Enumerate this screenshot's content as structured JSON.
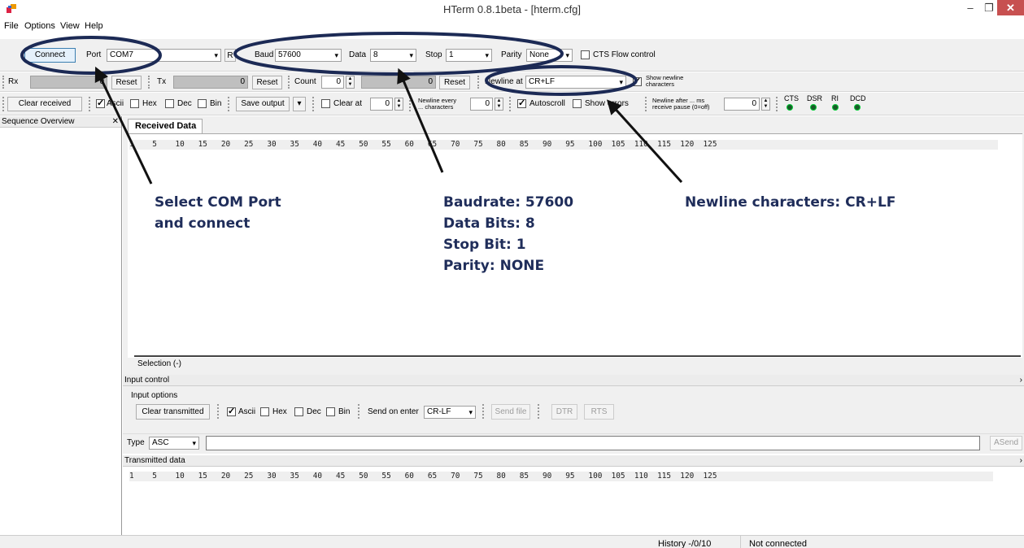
{
  "window": {
    "title": "HTerm 0.8.1beta - [hterm.cfg]",
    "min_glyph": "–",
    "max_glyph": "❐",
    "close_glyph": "✕"
  },
  "menu": [
    "File",
    "Options",
    "View",
    "Help"
  ],
  "connection": {
    "connect_label": "Connect",
    "port_label": "Port",
    "port_value": "COM7",
    "refresh_label": "R",
    "baud_label": "Baud",
    "baud_value": "57600",
    "data_label": "Data",
    "data_value": "8",
    "stop_label": "Stop",
    "stop_value": "1",
    "parity_label": "Parity",
    "parity_value": "None",
    "cts_label": "CTS Flow control"
  },
  "counters": {
    "rx_label": "Rx",
    "rx_value": "0",
    "reset_label": "Reset",
    "tx_label": "Tx",
    "tx_value": "0",
    "count_label": "Count",
    "count_value": "0",
    "count_total": "0",
    "newline_label": "Newline at",
    "newline_value": "CR+LF",
    "show_newline_label": "Show newline characters"
  },
  "receive_options": {
    "clear_received_label": "Clear received",
    "ascii": "Ascii",
    "hex": "Hex",
    "dec": "Dec",
    "bin": "Bin",
    "save_output_label": "Save output",
    "clear_at_label": "Clear at",
    "clear_at_value": "0",
    "newline_every_label": "Newline every ... characters",
    "newline_every_value": "0",
    "autoscroll_label": "Autoscroll",
    "show_errors_label": "Show errors",
    "newline_after_label": "Newline after ... ms receive pause (0=off)",
    "newline_after_value": "0",
    "signals": [
      "CTS",
      "DSR",
      "RI",
      "DCD"
    ]
  },
  "sequence_overview": {
    "title": "Sequence Overview",
    "close_glyph": "✕"
  },
  "received": {
    "tab_label": "Received Data",
    "ruler": "1    5    10   15   20   25   30   35   40   45   50   55   60   65   70   75   80   85   90   95   100  105  110  115  120  125",
    "selection_label": "Selection (-)"
  },
  "input_control": {
    "header": "Input control",
    "options_label": "Input options",
    "clear_transmitted_label": "Clear transmitted",
    "ascii": "Ascii",
    "hex": "Hex",
    "dec": "Dec",
    "bin": "Bin",
    "send_on_enter_label": "Send on enter",
    "send_on_enter_value": "CR-LF",
    "send_file_label": "Send file",
    "dtr_label": "DTR",
    "rts_label": "RTS",
    "type_label": "Type",
    "type_value": "ASC",
    "asend_label": "ASend"
  },
  "transmitted": {
    "header": "Transmitted data",
    "ruler": "1    5    10   15   20   25   30   35   40   45   50   55   60   65   70   75   80   85   90   95   100  105  110  115  120  125"
  },
  "status": {
    "history": "History -/0/10",
    "connection": "Not connected"
  },
  "annotations": {
    "com_port": [
      "Select COM Port",
      "and connect"
    ],
    "serial": [
      "Baudrate: 57600",
      "Data Bits: 8",
      "Stop Bit: 1",
      "Parity: NONE"
    ],
    "newline": [
      "Newline characters: CR+LF"
    ]
  },
  "colors": {
    "annotation": "#1f2d5a",
    "ellipse": "#1c2a55",
    "arrow": "#111111",
    "close_button": "#c75050"
  }
}
